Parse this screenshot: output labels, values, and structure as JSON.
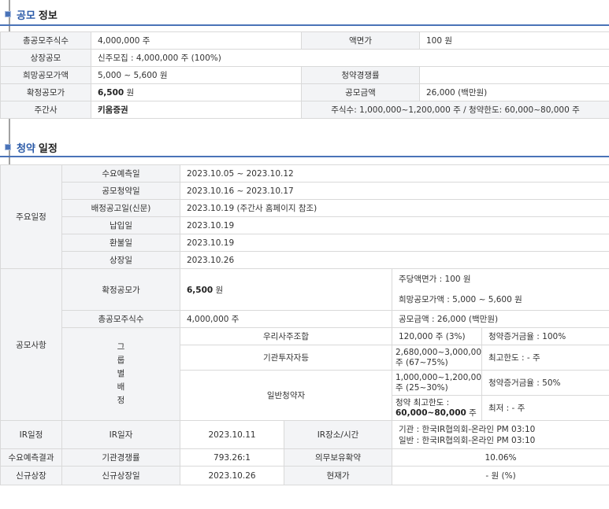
{
  "offering": {
    "heading_accent": "공모",
    "heading_rest": "정보",
    "total_shares_label": "총공모주식수",
    "total_shares_value": "4,000,000 주",
    "par_label": "액면가",
    "par_value": "100 원",
    "listing_label": "상장공모",
    "listing_value": "신주모집 : 4,000,000 주 (100%)",
    "desired_price_label": "희망공모가액",
    "desired_price_value": "5,000 ~ 5,600 원",
    "competition_label": "청약경쟁률",
    "competition_value": "",
    "final_price_label": "확정공모가",
    "final_price_num": "6,500",
    "final_price_unit": " 원",
    "amount_label": "공모금액",
    "amount_value": "26,000 (백만원)",
    "underwriter_label": "주간사",
    "underwriter_value": "키움증권",
    "underwriter_detail": "주식수: 1,000,000~1,200,000 주  /  청약한도: 60,000~80,000 주"
  },
  "subscription": {
    "heading_accent": "청약",
    "heading_rest": "일정",
    "schedule_group": "주요일정",
    "schedule": [
      {
        "label": "수요예측일",
        "value": "2023.10.05 ~ 2023.10.12"
      },
      {
        "label": "공모청약일",
        "value": "2023.10.16 ~ 2023.10.17"
      },
      {
        "label": "배정공고일(신문)",
        "value": "2023.10.19 (주간사 홈페이지 참조)"
      },
      {
        "label": "납입일",
        "value": "2023.10.19"
      },
      {
        "label": "환불일",
        "value": "2023.10.19"
      },
      {
        "label": "상장일",
        "value": "2023.10.26"
      }
    ],
    "matters_group": "공모사항",
    "final_price_label": "확정공모가",
    "final_price_num": "6,500",
    "final_price_unit": " 원",
    "par_per_share": "주당액면가 : 100 원",
    "desired_price": "희망공모가액 : 5,000 ~ 5,600 원",
    "total_shares_label": "총공모주식수",
    "total_shares_value": "4,000,000 주",
    "amount": "공모금액 : 26,000 (백만원)",
    "alloc_label": [
      "그",
      "룹",
      "별",
      "배",
      "정"
    ],
    "employee_label": "우리사주조합",
    "employee_shares": "120,000 주 (3%)",
    "employee_deposit": "청약증거금율 : 100%",
    "inst_label": "기관투자자등",
    "inst_shares": "2,680,000~3,000,000 주 (67~75%)",
    "inst_max": "최고한도 : - 주",
    "retail_label": "일반청약자",
    "retail_shares": "1,000,000~1,200,000 주 (25~30%)",
    "retail_deposit": "청약증거금율 : 50%",
    "retail_max_label": "청약 최고한도 :",
    "retail_max_value": "60,000~80,000",
    "retail_max_unit": " 주",
    "retail_min": "최저 : - 주",
    "ir_group": "IR일정",
    "ir_date_label": "IR일자",
    "ir_date": "2023.10.11",
    "ir_place_label": "IR장소/시간",
    "ir_inst": "기관 : 한국IR협의회-온라인 PM 03:10",
    "ir_retail": "일반 : 한국IR협의회-온라인 PM 03:10",
    "demand_group": "수요예측결과",
    "demand_comp_label": "기관경쟁률",
    "demand_comp": "793.26:1",
    "lockup_label": "의무보유확약",
    "lockup": "10.06%",
    "new_listing_group": "신규상장",
    "new_listing_label": "신규상장일",
    "new_listing_date": "2023.10.26",
    "current_price_label": "현재가",
    "current_price": "- 원 (%)"
  },
  "colors": {
    "accent": "#2c5ba8",
    "rule": "#4a73b8",
    "label_bg": "#f3f4f6",
    "border": "#d9d9d9"
  }
}
